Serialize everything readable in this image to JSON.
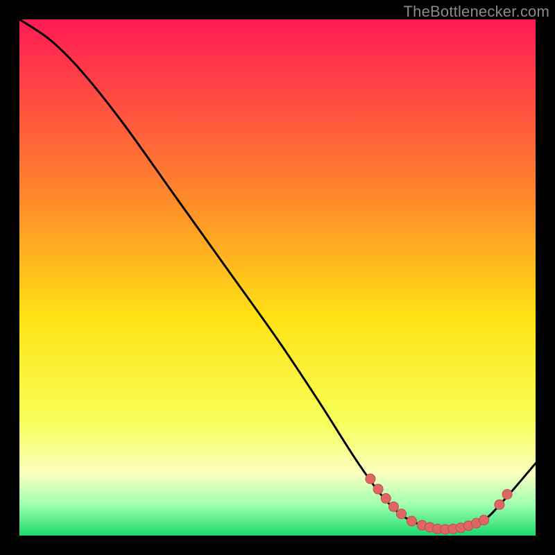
{
  "attribution": "TheBottlenecker.com",
  "colors": {
    "gradient_top": "#ff1a55",
    "gradient_mid_upper": "#ff8a2a",
    "gradient_mid": "#ffe314",
    "gradient_mid_lower": "#f7ff5a",
    "gradient_band_pale": "#faffc0",
    "gradient_green_light": "#9fffb0",
    "gradient_green": "#1bd96b",
    "curve": "#000000",
    "marker_fill": "#e06666",
    "marker_stroke": "#c24a4a",
    "frame_bg": "#000000"
  },
  "chart_data": {
    "type": "line",
    "title": "",
    "xlabel": "",
    "ylabel": "",
    "xlim": [
      0,
      100
    ],
    "ylim": [
      0,
      100
    ],
    "curve": [
      {
        "x": 0,
        "y": 100
      },
      {
        "x": 6,
        "y": 96
      },
      {
        "x": 12,
        "y": 90
      },
      {
        "x": 20,
        "y": 80
      },
      {
        "x": 30,
        "y": 66
      },
      {
        "x": 40,
        "y": 52
      },
      {
        "x": 50,
        "y": 38
      },
      {
        "x": 58,
        "y": 26
      },
      {
        "x": 65,
        "y": 15
      },
      {
        "x": 70,
        "y": 8
      },
      {
        "x": 74,
        "y": 4
      },
      {
        "x": 78,
        "y": 2
      },
      {
        "x": 82,
        "y": 1.2
      },
      {
        "x": 86,
        "y": 1.5
      },
      {
        "x": 90,
        "y": 3
      },
      {
        "x": 94,
        "y": 7
      },
      {
        "x": 100,
        "y": 14
      }
    ],
    "markers": [
      {
        "x": 68,
        "y": 11
      },
      {
        "x": 69.5,
        "y": 9
      },
      {
        "x": 71,
        "y": 7.2
      },
      {
        "x": 72.5,
        "y": 5.6
      },
      {
        "x": 74,
        "y": 4.2
      },
      {
        "x": 76,
        "y": 2.8
      },
      {
        "x": 78,
        "y": 2.0
      },
      {
        "x": 79.5,
        "y": 1.6
      },
      {
        "x": 81,
        "y": 1.3
      },
      {
        "x": 82.5,
        "y": 1.2
      },
      {
        "x": 84,
        "y": 1.3
      },
      {
        "x": 85.5,
        "y": 1.5
      },
      {
        "x": 87,
        "y": 1.9
      },
      {
        "x": 88.5,
        "y": 2.4
      },
      {
        "x": 90,
        "y": 3.0
      },
      {
        "x": 93,
        "y": 6.0
      },
      {
        "x": 94.5,
        "y": 8.0
      }
    ]
  }
}
